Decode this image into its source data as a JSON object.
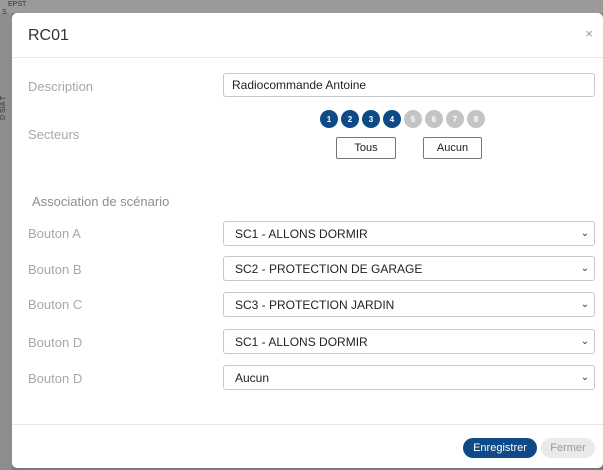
{
  "background": {
    "text_top": "EPST",
    "text_top2": "S",
    "text_side": "D S/A T"
  },
  "modal": {
    "title": "RC01",
    "close_glyph": "×",
    "description_label": "Description",
    "description_value": "Radiocommande Antoine",
    "sectors_label": "Secteurs",
    "sectors": [
      {
        "label": "1",
        "active": true
      },
      {
        "label": "2",
        "active": true
      },
      {
        "label": "3",
        "active": true
      },
      {
        "label": "4",
        "active": true
      },
      {
        "label": "5",
        "active": false
      },
      {
        "label": "6",
        "active": false
      },
      {
        "label": "7",
        "active": false
      },
      {
        "label": "8",
        "active": false
      }
    ],
    "all_button": "Tous",
    "none_button": "Aucun",
    "association_label": "Association de scénario",
    "buttons": [
      {
        "label": "Bouton A",
        "value": "SC1 - ALLONS DORMIR"
      },
      {
        "label": "Bouton B",
        "value": "SC2 - PROTECTION DE GARAGE"
      },
      {
        "label": "Bouton C",
        "value": "SC3 - PROTECTION JARDIN"
      },
      {
        "label": "Bouton D",
        "value": "SC1 - ALLONS DORMIR"
      },
      {
        "label": "Bouton D",
        "value": "Aucun"
      }
    ],
    "save_button": "Enregistrer",
    "close_button": "Fermer"
  },
  "colors": {
    "accent": "#0d4a87",
    "inactive_sector": "#c4c4c4"
  },
  "icons": {
    "select_chevron": "chevron-down-icon",
    "close": "close-icon"
  }
}
